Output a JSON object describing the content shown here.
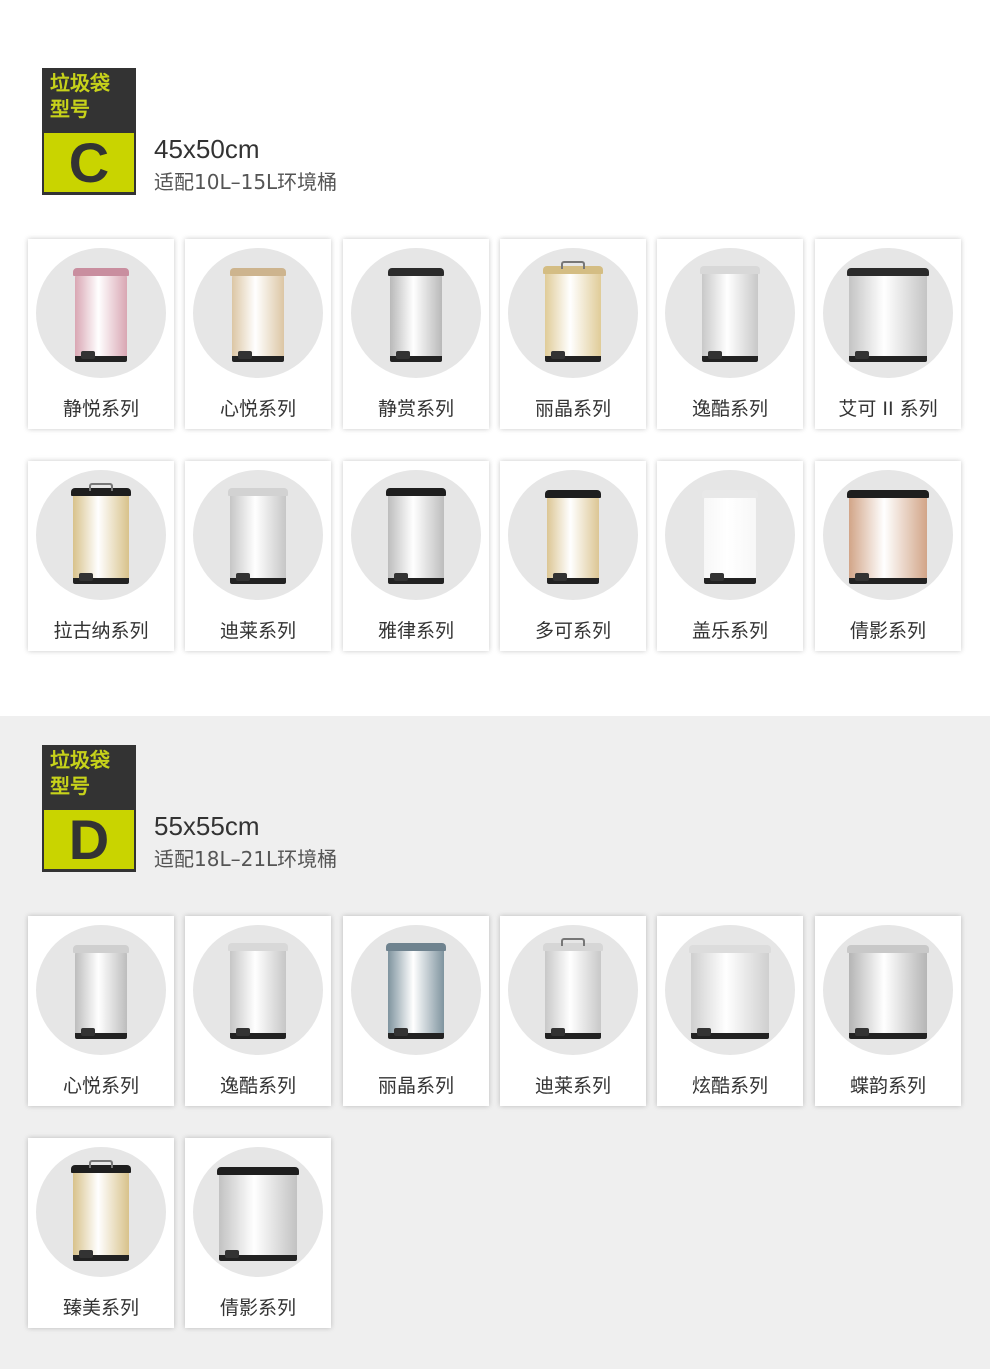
{
  "sections": [
    {
      "badge_line1": "垃圾袋",
      "badge_line2": "型号",
      "letter": "C",
      "size": "45x50cm",
      "fit": "适配10L–15L环境桶",
      "products": [
        {
          "name": "静悦系列",
          "shape": "round",
          "color": "#d9a6b3",
          "lid": "#c98e9f"
        },
        {
          "name": "心悦系列",
          "shape": "round",
          "color": "#dcc6a4",
          "lid": "#cdb48e"
        },
        {
          "name": "静赏系列",
          "shape": "round",
          "color": "#b9b9b9",
          "lid": "#2b2b2b"
        },
        {
          "name": "丽晶系列",
          "shape": "square",
          "color": "#e0cc98",
          "lid": "#d4bd83"
        },
        {
          "name": "逸酷系列",
          "shape": "square",
          "color": "#c8c8c8",
          "lid": "#d8d8d8"
        },
        {
          "name": "艾可 II 系列",
          "shape": "wide",
          "color": "#c4c4c4",
          "lid": "#2b2b2b"
        },
        {
          "name": "拉古纳系列",
          "shape": "square",
          "color": "#d8c28b",
          "lid": "#1e1e1e"
        },
        {
          "name": "迪莱系列",
          "shape": "square",
          "color": "#c6c6c6",
          "lid": "#d2d2d2"
        },
        {
          "name": "雅律系列",
          "shape": "square",
          "color": "#bdbdbd",
          "lid": "#1e1e1e"
        },
        {
          "name": "多可系列",
          "shape": "round",
          "color": "#dcc694",
          "lid": "#1e1e1e"
        },
        {
          "name": "盖乐系列",
          "shape": "round",
          "color": "#f7f7f7",
          "lid": "#e8e8e8"
        },
        {
          "name": "倩影系列",
          "shape": "wide",
          "color": "#d2a588",
          "lid": "#1e1e1e"
        }
      ]
    },
    {
      "badge_line1": "垃圾袋",
      "badge_line2": "型号",
      "letter": "D",
      "size": "55x55cm",
      "fit": "适配18L–21L环境桶",
      "products": [
        {
          "name": "心悦系列",
          "shape": "round",
          "color": "#bdbdbd",
          "lid": "#cfcfcf"
        },
        {
          "name": "逸酷系列",
          "shape": "square",
          "color": "#c6c6c6",
          "lid": "#d8d8d8"
        },
        {
          "name": "丽晶系列",
          "shape": "square",
          "color": "#7f949f",
          "lid": "#6f838f"
        },
        {
          "name": "迪莱系列",
          "shape": "square",
          "color": "#c8c8c8",
          "lid": "#d6d6d6"
        },
        {
          "name": "炫酷系列",
          "shape": "wide",
          "color": "#cfcfcf",
          "lid": "#dcdcdc"
        },
        {
          "name": "蝶韵系列",
          "shape": "wide",
          "color": "#b5b5b5",
          "lid": "#c8c8c8"
        },
        {
          "name": "臻美系列",
          "shape": "square",
          "color": "#d8c28b",
          "lid": "#1e1e1e"
        },
        {
          "name": "倩影系列",
          "shape": "wide",
          "color": "#c2c2c2",
          "lid": "#1e1e1e"
        }
      ]
    }
  ]
}
